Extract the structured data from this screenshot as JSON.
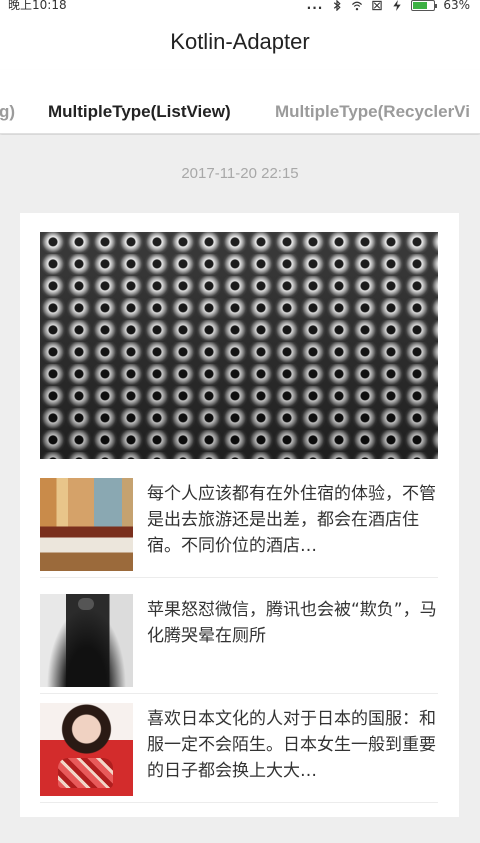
{
  "status_bar": {
    "time": "晚上10:18",
    "more": "...",
    "battery_percent": "63%",
    "battery_level": 0.63,
    "icons": [
      "bluetooth-icon",
      "wifi-icon",
      "sim-icon",
      "charging-icon",
      "battery-icon"
    ]
  },
  "toolbar": {
    "title": "Kotlin-Adapter"
  },
  "tabs": [
    {
      "label": "g)",
      "selected": false
    },
    {
      "label": "MultipleType(ListView)",
      "selected": true
    },
    {
      "label": "MultipleType(RecyclerVi",
      "selected": false
    }
  ],
  "content": {
    "timestamp": "2017-11-20 22:15",
    "hero_image": "perforated-metal-image",
    "items": [
      {
        "text": "每个人应该都有在外住宿的体验，不管是出去旅游还是出差，都会在酒店住宿。不同价位的酒店…",
        "thumb": "hotel-room-image"
      },
      {
        "text": "苹果怒怼微信，腾讯也会被“欺负”，马化腾哭晕在厕所",
        "thumb": "phone-image"
      },
      {
        "text": "喜欢日本文化的人对于日本的国服：和服一定不会陌生。日本女生一般到重要的日子都会换上大大…",
        "thumb": "kimono-girl-image"
      }
    ]
  },
  "colors": {
    "background": "#eeeeee",
    "card": "#ffffff",
    "tab_active": "#222222",
    "tab_inactive": "#9b9b9b",
    "timestamp": "#a8a8a8",
    "battery": "#3cb043"
  }
}
